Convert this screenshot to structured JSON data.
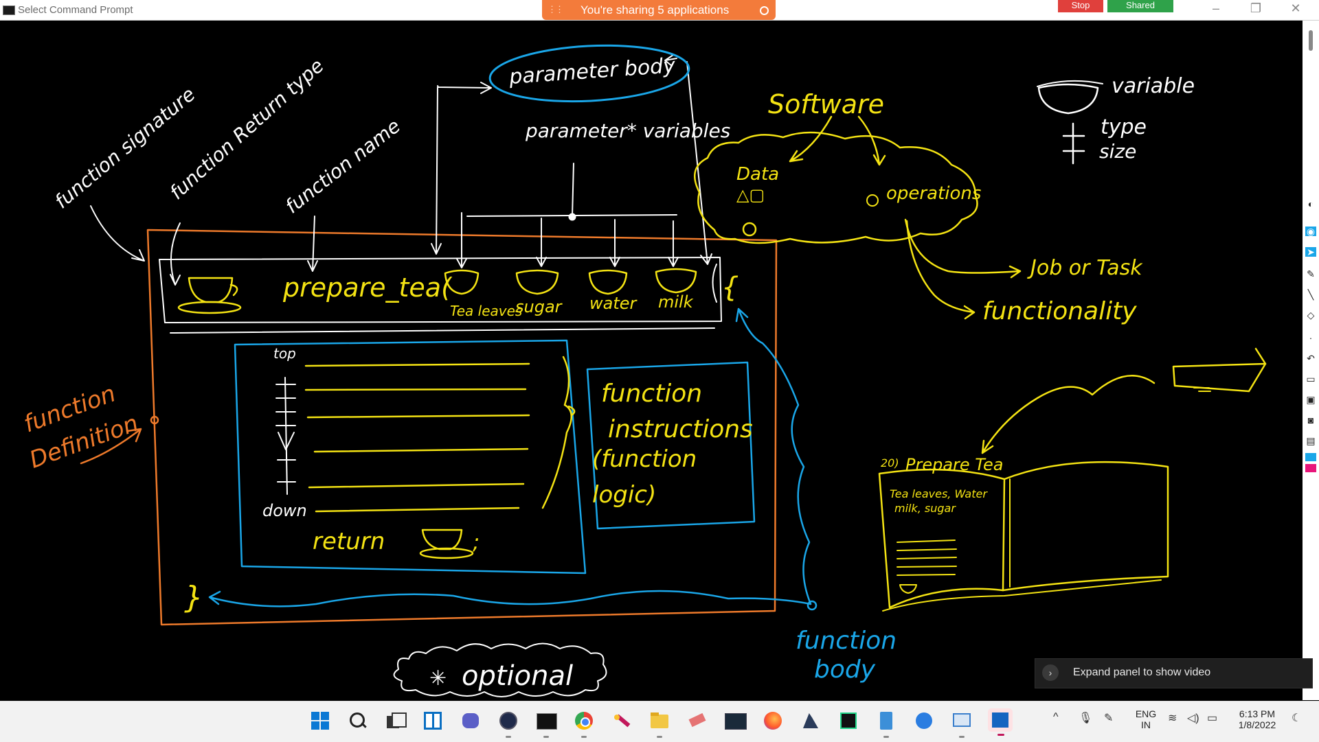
{
  "window": {
    "title": "Select Command Prompt"
  },
  "share_banner": {
    "text": "You're sharing 5 applications",
    "stop_label": "Stop",
    "shared_label": "Shared"
  },
  "whiteboard": {
    "labels": {
      "function_signature": "function signature",
      "function_return_type": "function Return type",
      "function_name": "function name",
      "parameter_body": "parameter body",
      "parameter_variables": "parameter* variables",
      "signature_code": "prepare_tea(",
      "param_tea": "Tea leaves",
      "param_sugar": "sugar",
      "param_water": "water",
      "param_milk": "milk",
      "open_brace": "{",
      "close_brace": "}",
      "top": "top",
      "down": "down",
      "return_kw": "return",
      "semicolon": ";",
      "function_instructions": "function instructions",
      "function_logic": "(function logic)",
      "function_definition": "function Definition",
      "function_body": "function body",
      "optional": "optional",
      "software": "Software",
      "data": "Data",
      "operations": "operations",
      "job_or_task": "Job or Task",
      "functionality": "functionality",
      "variable": "variable",
      "type": "type",
      "size": "size",
      "book_number": "20)",
      "book_title": "Prepare Tea",
      "book_ingredients_1": "Tea leaves, Water",
      "book_ingredients_2": "milk, sugar"
    },
    "colors": {
      "white": "#ffffff",
      "yellow": "#f4e313",
      "blue": "#1aa6e8",
      "orange": "#ee7a2b"
    }
  },
  "video_panel": {
    "text": "Expand panel to show video"
  },
  "taskbar": {
    "apps": [
      "start-icon",
      "search-icon",
      "task-view-icon",
      "widgets-icon",
      "teams-chat-icon",
      "media-player-icon",
      "terminal-icon",
      "chrome-icon",
      "paint-brush-icon",
      "file-explorer-icon",
      "eraser-app-icon",
      "mysql-icon",
      "firefox-icon",
      "kali-icon",
      "pycharm-icon",
      "notepad-icon",
      "maps-icon",
      "remote-desktop-icon",
      "whiteboard-app-icon"
    ],
    "lang_1": "ENG",
    "lang_2": "IN",
    "time": "6:13 PM",
    "date": "1/8/2022"
  }
}
